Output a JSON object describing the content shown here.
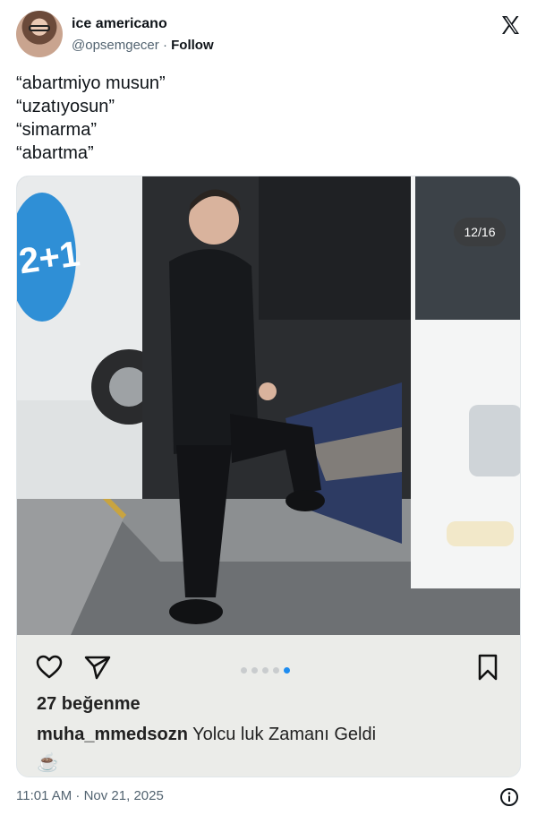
{
  "author": {
    "display_name": "ice americano",
    "handle": "@opsemgecer",
    "separator": "·",
    "follow_label": "Follow"
  },
  "tweet": {
    "lines": [
      "“abartmiyo musun”",
      "“uzatıyosun”",
      "“simarma”",
      "“abartma”"
    ],
    "timestamp": "11:01 AM · Nov 21, 2025"
  },
  "media": {
    "counter": "12/16",
    "bus_sign": "2+1",
    "instagram": {
      "likes": "27 beğenme",
      "username": "muha_mmedsozn",
      "caption": "Yolcu luk Zamanı Geldi",
      "extra": "☕",
      "dots_total": 5,
      "dot_active_index": 4
    }
  },
  "icons": {
    "platform": "x-logo-icon",
    "like": "heart-icon",
    "share": "send-icon",
    "save": "bookmark-icon",
    "info": "info-icon"
  },
  "colors": {
    "text": "#0f1419",
    "muted": "#536471",
    "accent_dot": "#1d8cf0",
    "bus_sign": "#2f8fd6"
  }
}
